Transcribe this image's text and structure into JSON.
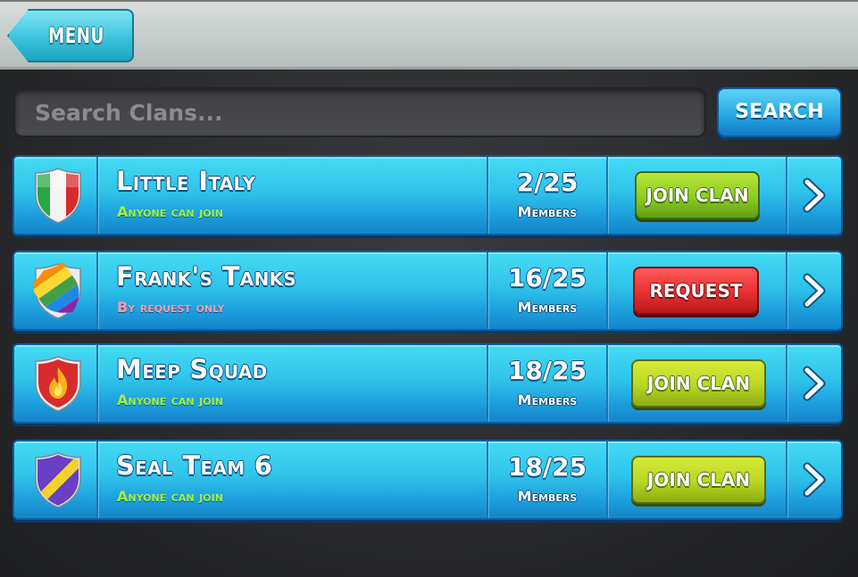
{
  "header": {
    "menu_label": "MENU"
  },
  "search": {
    "placeholder": "Search Clans...",
    "button_label": "SEARCH"
  },
  "clans": [
    {
      "name": "Little Italy",
      "join_type": "Anyone can join",
      "members": "2/25",
      "members_label": "Members",
      "action": "JOIN CLAN",
      "badge": "italy-flag-shield-icon"
    },
    {
      "name": "Frank's Tanks",
      "join_type": "By request only",
      "members": "16/25",
      "members_label": "Members",
      "action": "REQUEST",
      "badge": "rainbow-shield-icon"
    },
    {
      "name": "Meep Squad",
      "join_type": "Anyone can join",
      "members": "18/25",
      "members_label": "Members",
      "action": "JOIN CLAN",
      "badge": "flame-shield-icon"
    },
    {
      "name": "Seal Team 6",
      "join_type": "Anyone can join",
      "members": "18/25",
      "members_label": "Members",
      "action": "JOIN CLAN",
      "badge": "striped-shield-icon"
    }
  ],
  "colors": {
    "join_open": "#a6f03c",
    "join_request": "#ff9aa8",
    "row_blue": "#2fc3ea",
    "button_green": "#8ccc22",
    "button_red": "#e63030"
  }
}
